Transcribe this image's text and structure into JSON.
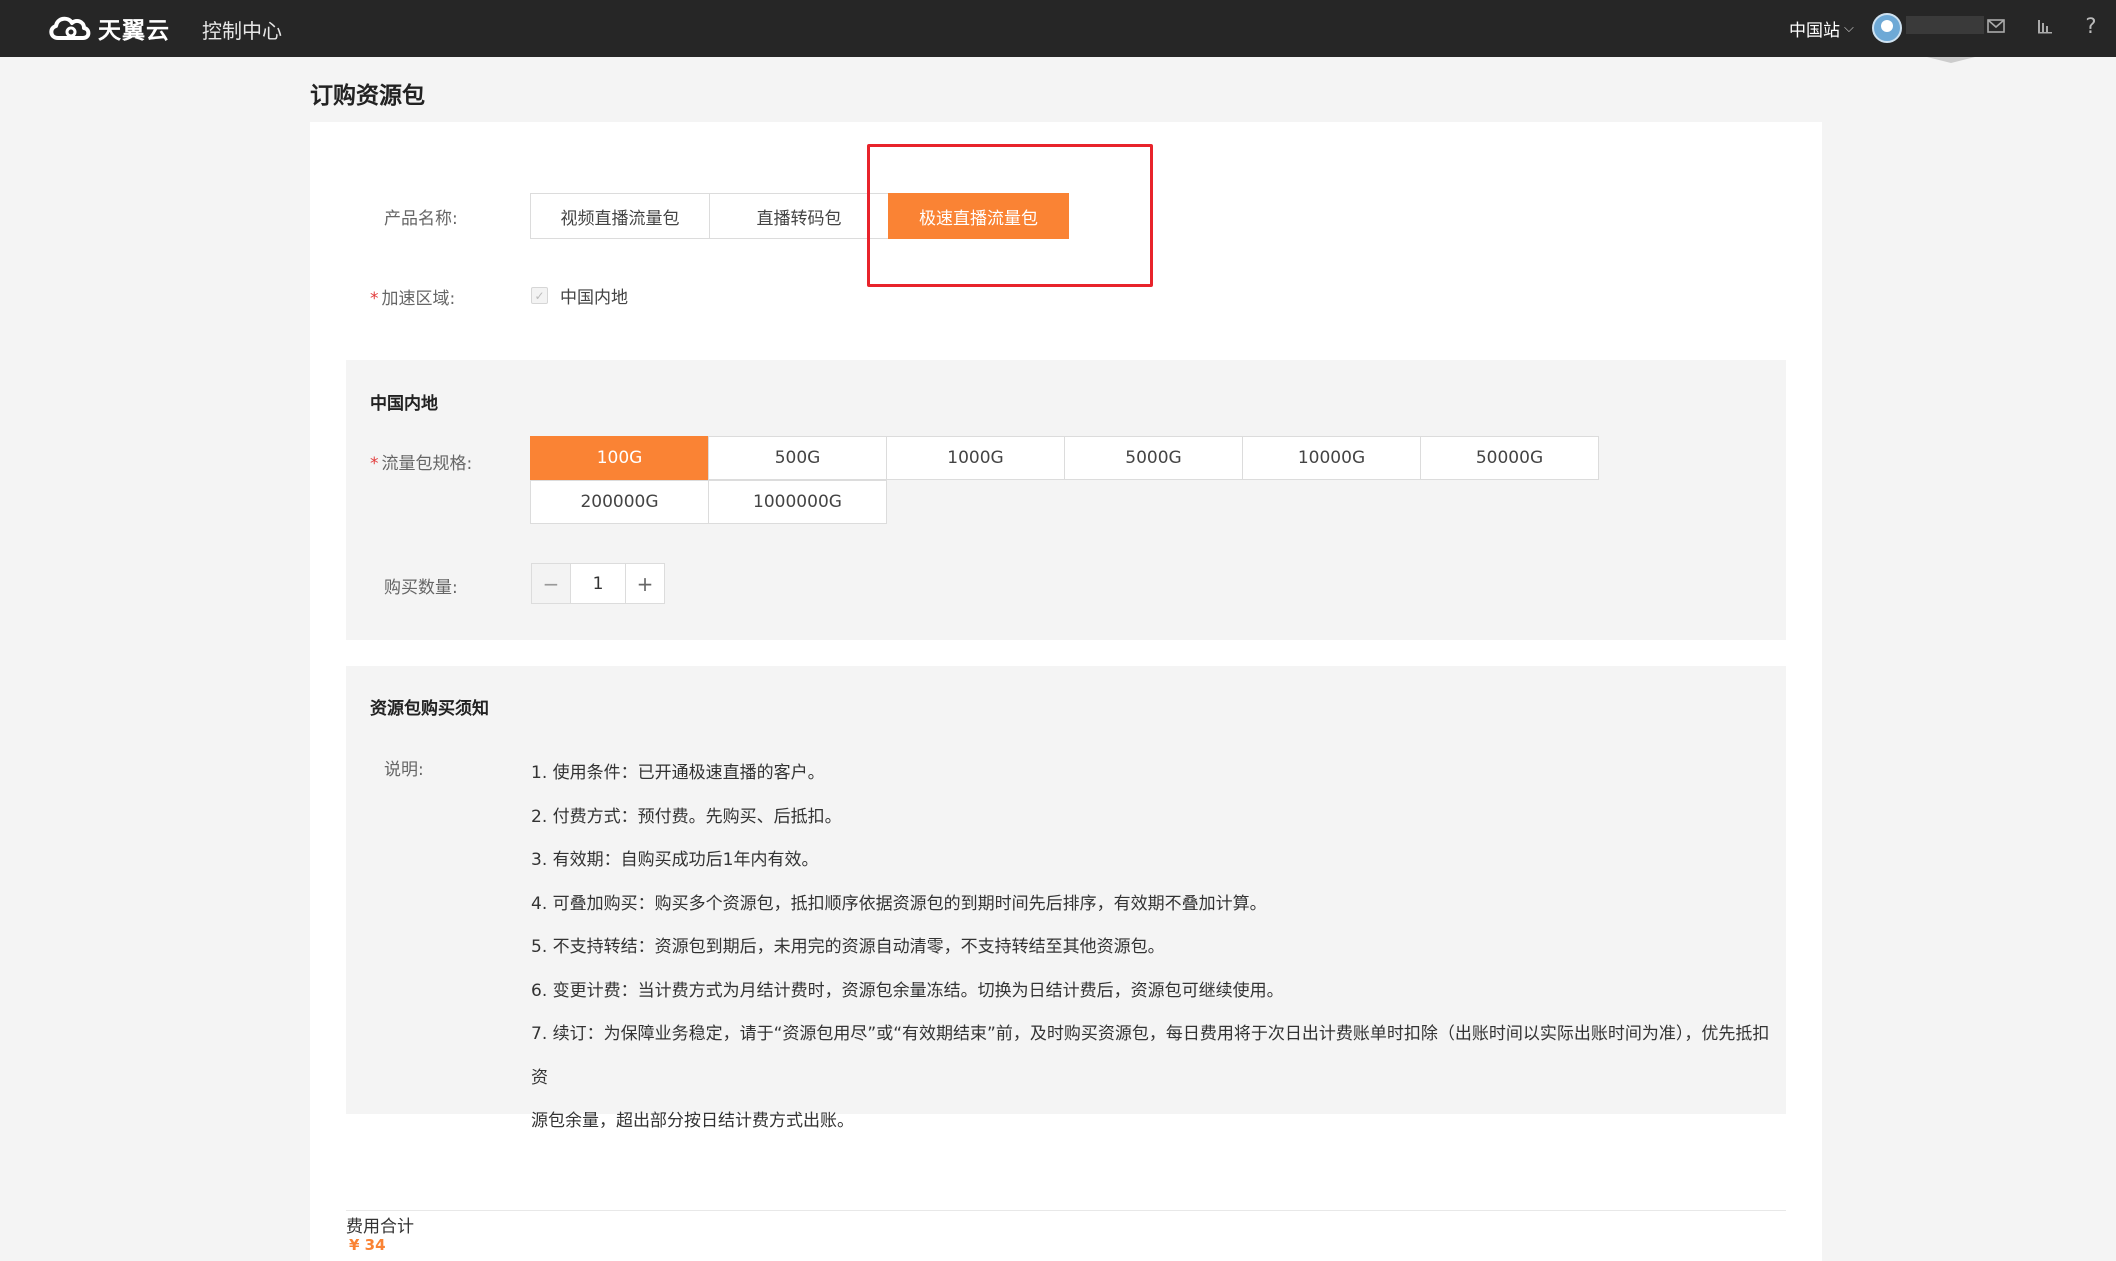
{
  "topbar": {
    "logo_text": "天翼云",
    "console": "控制中心",
    "site": "中国站",
    "icons": [
      "cloud-logo-icon",
      "chevron-down-icon",
      "mail-icon",
      "chart-icon",
      "help-icon"
    ],
    "help_glyph": "?"
  },
  "page": {
    "title": "订购资源包"
  },
  "form": {
    "product_label": "产品名称:",
    "products": [
      "视频直播流量包",
      "直播转码包",
      "极速直播流量包"
    ],
    "selected_product": "极速直播流量包",
    "region_label": "加速区域:",
    "region_option": "中国内地",
    "region_checked": true,
    "required_mark": "*"
  },
  "spec_panel": {
    "title": "中国内地",
    "spec_label": "流量包规格:",
    "specs_row1": [
      "100G",
      "500G",
      "1000G",
      "5000G",
      "10000G",
      "50000G"
    ],
    "specs_row2": [
      "200000G",
      "1000000G"
    ],
    "selected_spec": "100G",
    "quantity_label": "购买数量:",
    "quantity": "1",
    "minus": "−",
    "plus": "+"
  },
  "notice_panel": {
    "title": "资源包购买须知",
    "desc_label": "说明:",
    "lines": [
      "1. 使用条件：已开通极速直播的客户。",
      "2. 付费方式：预付费。先购买、后抵扣。",
      "3. 有效期：自购买成功后1年内有效。",
      "4. 可叠加购买：购买多个资源包，抵扣顺序依据资源包的到期时间先后排序，有效期不叠加计算。",
      "5. 不支持转结：资源包到期后，未用完的资源自动清零，不支持转结至其他资源包。",
      "6. 变更计费：当计费方式为月结计费时，资源包余量冻结。切换为日结计费后，资源包可继续使用。",
      "7. 续订：为保障业务稳定，请于“资源包用尽”或“有效期结束”前，及时购买资源包，每日费用将于次日出计费账单时扣除（出账时间以实际出账时间为准），优先抵扣资",
      "源包余量，超出部分按日结计费方式出账。"
    ]
  },
  "footer": {
    "total_label": "费用合计",
    "total_price": "¥ 34"
  },
  "colors": {
    "accent": "#fa8334",
    "highlight": "#e8232b",
    "topbar": "#262626"
  }
}
